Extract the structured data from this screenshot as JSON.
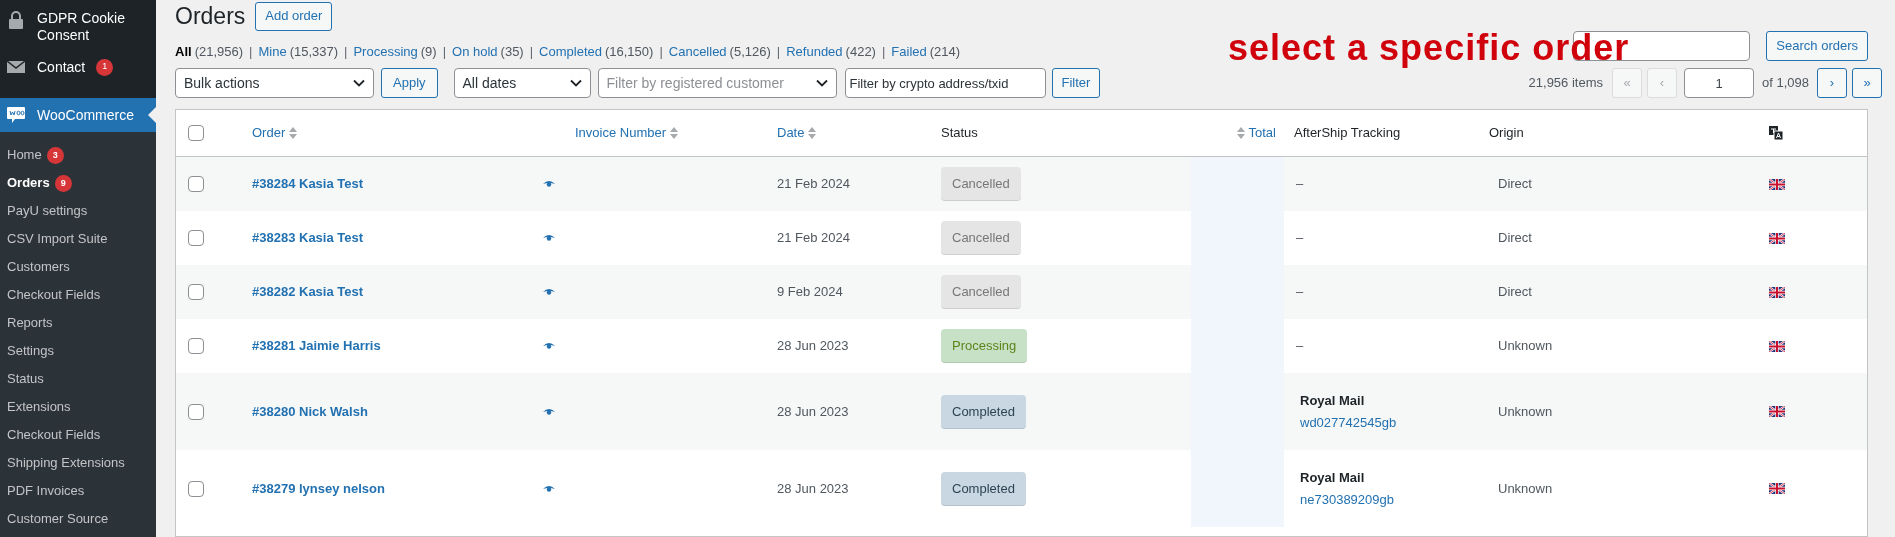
{
  "sidebar": {
    "items": [
      {
        "label": "GDPR Cookie Consent",
        "current": false
      },
      {
        "label": "Contact",
        "badge": "1",
        "current": false
      },
      {
        "label": "WooCommerce",
        "current": true
      }
    ],
    "submenu": [
      {
        "label": "Home",
        "badge": "3",
        "selected": false
      },
      {
        "label": "Orders",
        "badge": "9",
        "selected": true
      },
      {
        "label": "PayU settings",
        "selected": false
      },
      {
        "label": "CSV Import Suite",
        "selected": false
      },
      {
        "label": "Customers",
        "selected": false
      },
      {
        "label": "Checkout Fields",
        "selected": false
      },
      {
        "label": "Reports",
        "selected": false
      },
      {
        "label": "Settings",
        "selected": false
      },
      {
        "label": "Status",
        "selected": false
      },
      {
        "label": "Extensions",
        "selected": false
      },
      {
        "label": "Checkout Fields",
        "selected": false
      },
      {
        "label": "Shipping Extensions",
        "selected": false
      },
      {
        "label": "PDF Invoices",
        "selected": false
      },
      {
        "label": "Customer Source",
        "selected": false
      }
    ]
  },
  "page": {
    "title": "Orders",
    "add_button": "Add order"
  },
  "status_filters": [
    {
      "label": "All",
      "count": "(21,956)",
      "selected": true
    },
    {
      "separator": "|",
      "label": "Mine",
      "count": "(15,337)",
      "selected": false
    },
    {
      "separator": "|",
      "label": "Processing",
      "count": "(9)",
      "selected": false
    },
    {
      "separator": "|",
      "label": "On hold",
      "count": "(35)",
      "selected": false
    },
    {
      "separator": "|",
      "label": "Completed",
      "count": "(16,150)",
      "selected": false
    },
    {
      "separator": "|",
      "label": "Cancelled",
      "count": "(5,126)",
      "selected": false
    },
    {
      "separator": "|",
      "label": "Refunded",
      "count": "(422)",
      "selected": false
    },
    {
      "separator": "|",
      "label": "Failed",
      "count": "(214)",
      "selected": false
    }
  ],
  "filters": {
    "bulk_actions": "Bulk actions",
    "apply": "Apply",
    "dates": "All dates",
    "customer_placeholder": "Filter by registered customer",
    "crypto_placeholder": "Filter by crypto address/txid",
    "filter_button": "Filter"
  },
  "search": {
    "button": "Search orders"
  },
  "pagination": {
    "items": "21,956 items",
    "first": "«",
    "prev": "‹",
    "page": "1",
    "of": "of 1,098",
    "next": "›",
    "last": "»"
  },
  "annotation": "select a specific order",
  "table": {
    "select_all_checked": false,
    "columns": [
      {
        "label": "Order",
        "sortable": true,
        "kind": "text"
      },
      {
        "label": "Invoice Number",
        "sortable": true,
        "kind": "text"
      },
      {
        "label": "Date",
        "sortable": true,
        "kind": "text"
      },
      {
        "label": "Status",
        "sortable": false,
        "kind": "text"
      },
      {
        "label": "Total",
        "sortable": true,
        "kind": "numeric"
      },
      {
        "label": "AfterShip Tracking",
        "sortable": false,
        "kind": "text"
      },
      {
        "label": "Origin",
        "sortable": false,
        "kind": "text"
      }
    ],
    "rows": [
      {
        "checked": false,
        "order": "#38284 Kasia Test",
        "date": "21 Feb 2024",
        "status": {
          "label": "Cancelled",
          "kind": "cancelled"
        },
        "tracking": {
          "kind": "none",
          "text": "–"
        },
        "origin": "Direct"
      },
      {
        "checked": false,
        "order": "#38283 Kasia Test",
        "date": "21 Feb 2024",
        "status": {
          "label": "Cancelled",
          "kind": "cancelled"
        },
        "tracking": {
          "kind": "none",
          "text": "–"
        },
        "origin": "Direct"
      },
      {
        "checked": false,
        "order": "#38282 Kasia Test",
        "date": "9 Feb 2024",
        "status": {
          "label": "Cancelled",
          "kind": "cancelled"
        },
        "tracking": {
          "kind": "none",
          "text": "–"
        },
        "origin": "Direct"
      },
      {
        "checked": false,
        "order": "#38281 Jaimie Harris",
        "date": "28 Jun 2023",
        "status": {
          "label": "Processing",
          "kind": "processing"
        },
        "tracking": {
          "kind": "none",
          "text": "–"
        },
        "origin": "Unknown"
      },
      {
        "checked": false,
        "order": "#38280 Nick Walsh",
        "date": "28 Jun 2023",
        "status": {
          "label": "Completed",
          "kind": "completed"
        },
        "tracking": {
          "kind": "shipment",
          "carrier": "Royal Mail",
          "number": "wd027742545gb"
        },
        "origin": "Unknown"
      },
      {
        "checked": false,
        "order": "#38279 lynsey nelson",
        "date": "28 Jun 2023",
        "status": {
          "label": "Completed",
          "kind": "completed"
        },
        "tracking": {
          "kind": "shipment",
          "carrier": "Royal Mail",
          "number": "ne730389209gb"
        },
        "origin": "Unknown"
      }
    ]
  }
}
